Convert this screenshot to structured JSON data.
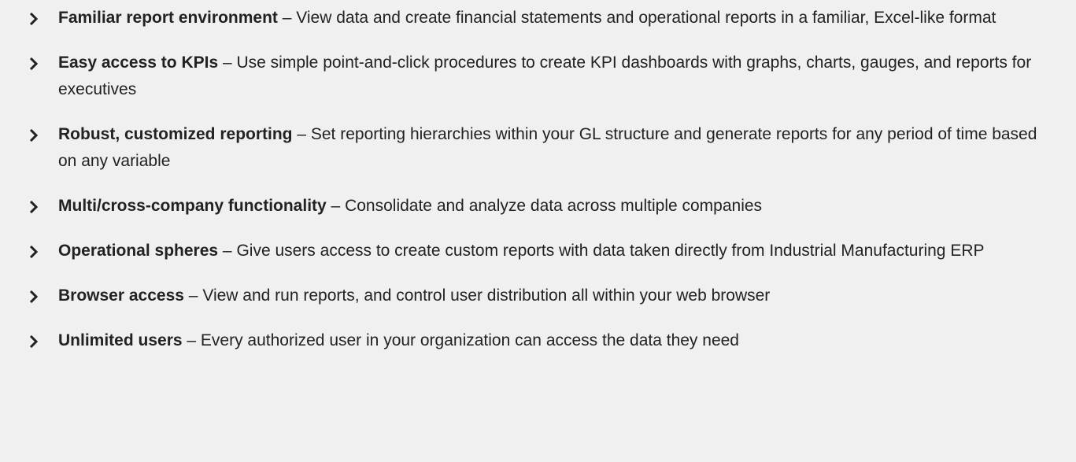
{
  "features": [
    {
      "title": "Familiar report environment",
      "separator": " – ",
      "description": "View data and create financial statements and operational reports in a familiar, Excel-like format"
    },
    {
      "title": "Easy access to KPIs",
      "separator": " – ",
      "description": "Use simple point-and-click procedures to create KPI dashboards with graphs, charts, gauges, and reports for executives"
    },
    {
      "title": "Robust, customized reporting",
      "separator": " – ",
      "description": "Set reporting hierarchies within your GL structure and generate reports for any period of time based on any variable"
    },
    {
      "title": "Multi/cross-company functionality",
      "separator": " – ",
      "description": "Consolidate and analyze data across multiple companies"
    },
    {
      "title": "Operational spheres",
      "separator": " – ",
      "description": "Give users access to create custom reports with data taken directly from Industrial Manufacturing ERP"
    },
    {
      "title": "Browser access",
      "separator": " – ",
      "description": "View and run reports, and control user distribution all within your web browser"
    },
    {
      "title": "Unlimited users",
      "separator": " – ",
      "description": "Every authorized user in your organization can access the data they need"
    }
  ],
  "colors": {
    "background": "#f0f0f0",
    "text": "#222222"
  },
  "icons": {
    "bullet": "chevron-right-icon"
  }
}
